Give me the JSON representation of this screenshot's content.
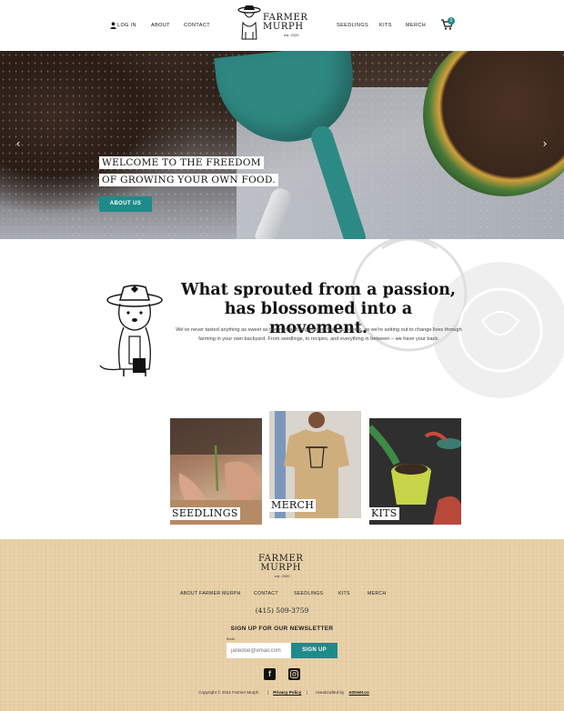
{
  "header": {
    "login": "LOG IN",
    "about": "ABOUT",
    "contact": "CONTACT",
    "logo_line1": "FARMER",
    "logo_line2": "MURPH",
    "logo_est": "est. 2020",
    "seedlings": "SEEDLINGS",
    "kits": "KITS",
    "merch": "MERCH",
    "cart_count": "0"
  },
  "hero": {
    "title_line1": "WELCOME TO THE FREEDOM",
    "title_line2": "OF GROWING YOUR OWN FOOD.",
    "button": "ABOUT US",
    "prev": "‹",
    "next": "›"
  },
  "story": {
    "title": "What sprouted from a passion, has blossomed into a movement.",
    "body": "We've never tasted anything as sweet as the fruit (and vegetables) from our labors, so we're setting out to change lives through farming in your own backyard. From seedlings, to recipes, and everything in between – we have your back."
  },
  "tiles": {
    "seedlings": "SEEDLINGS",
    "merch": "MERCH",
    "kits": "KITS"
  },
  "footer": {
    "logo_line1": "FARMER",
    "logo_line2": "MURPH",
    "logo_est": "est. 2020",
    "links": [
      "ABOUT FARMER MURPH",
      "CONTACT",
      "SEEDLINGS",
      "KITS",
      "MERCH"
    ],
    "phone": "(415) 509-3759",
    "newsletter_title": "SIGN UP FOR OUR NEWSLETTER",
    "email_label": "Email",
    "email_placeholder": "janedoe@email.com",
    "signup_button": "SIGN UP",
    "copyright": "Copyright © 2021 Farmer Murph",
    "privacy": "Privacy Policy",
    "handcrafted": "Handcrafted by",
    "agency": "eStreet.co",
    "separator": "|"
  },
  "colors": {
    "accent": "#1f8a8a",
    "footer_bg": "#e7cfa6"
  },
  "icons": [
    "user-icon",
    "cart-icon",
    "chevron-left-icon",
    "chevron-right-icon",
    "facebook-icon",
    "instagram-icon",
    "dog-mascot-illustration",
    "tomato-illustration"
  ]
}
